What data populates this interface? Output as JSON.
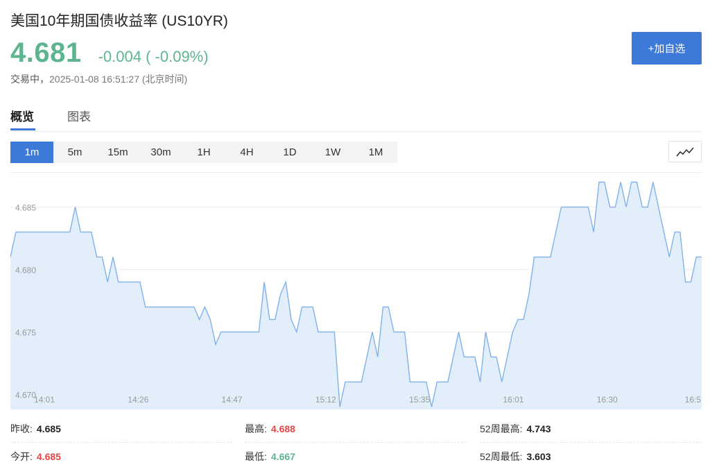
{
  "header": {
    "title": "美国10年期国债收益率 (US10YR)",
    "price": "4.681",
    "change": "-0.004 ( -0.09%)",
    "status": "交易中，",
    "timestamp": "2025-01-08 16:51:27",
    "timezone": "(北京时间)",
    "watch_button": "+加自选"
  },
  "tabs": [
    {
      "label": "概览",
      "active": true
    },
    {
      "label": "图表",
      "active": false
    }
  ],
  "periods": [
    {
      "label": "1m",
      "active": true
    },
    {
      "label": "5m",
      "active": false
    },
    {
      "label": "15m",
      "active": false
    },
    {
      "label": "30m",
      "active": false
    },
    {
      "label": "1H",
      "active": false
    },
    {
      "label": "4H",
      "active": false
    },
    {
      "label": "1D",
      "active": false
    },
    {
      "label": "1W",
      "active": false
    },
    {
      "label": "1M",
      "active": false
    }
  ],
  "chart_type_icon": "line-chart-icon",
  "colors": {
    "accent": "#3d79d8",
    "up": "#e64545",
    "down": "#5cb58e",
    "line": "#7fb1ec",
    "fill": "#e3eefb"
  },
  "chart_data": {
    "type": "area",
    "x_ticks": [
      "14:01",
      "14:26",
      "14:47",
      "15:12",
      "15:35",
      "16:01",
      "16:30",
      "16:5"
    ],
    "y_ticks": [
      "4.685",
      "4.680",
      "4.675",
      "4.670"
    ],
    "ylim": [
      4.6688,
      4.6878
    ],
    "values": [
      4.681,
      4.683,
      4.683,
      4.683,
      4.683,
      4.683,
      4.683,
      4.683,
      4.683,
      4.683,
      4.683,
      4.683,
      4.685,
      4.683,
      4.683,
      4.683,
      4.681,
      4.681,
      4.679,
      4.681,
      4.679,
      4.679,
      4.679,
      4.679,
      4.679,
      4.677,
      4.677,
      4.677,
      4.677,
      4.677,
      4.677,
      4.677,
      4.677,
      4.677,
      4.677,
      4.676,
      4.677,
      4.676,
      4.674,
      4.675,
      4.675,
      4.675,
      4.675,
      4.675,
      4.675,
      4.675,
      4.675,
      4.679,
      4.676,
      4.676,
      4.678,
      4.679,
      4.676,
      4.675,
      4.677,
      4.677,
      4.677,
      4.675,
      4.675,
      4.675,
      4.675,
      4.669,
      4.671,
      4.671,
      4.671,
      4.671,
      4.673,
      4.675,
      4.673,
      4.677,
      4.677,
      4.675,
      4.675,
      4.675,
      4.671,
      4.671,
      4.671,
      4.671,
      4.669,
      4.671,
      4.671,
      4.671,
      4.673,
      4.675,
      4.673,
      4.673,
      4.673,
      4.671,
      4.675,
      4.673,
      4.673,
      4.671,
      4.673,
      4.675,
      4.676,
      4.676,
      4.678,
      4.681,
      4.681,
      4.681,
      4.681,
      4.683,
      4.685,
      4.685,
      4.685,
      4.685,
      4.685,
      4.685,
      4.683,
      4.687,
      4.687,
      4.685,
      4.685,
      4.687,
      4.685,
      4.687,
      4.687,
      4.685,
      4.685,
      4.687,
      4.685,
      4.683,
      4.681,
      4.683,
      4.683,
      4.679,
      4.679,
      4.681,
      4.681
    ]
  },
  "stats": {
    "prev_close_label": "昨收:",
    "prev_close": "4.685",
    "open_label": "今开:",
    "open": "4.685",
    "high_label": "最高:",
    "high": "4.688",
    "low_label": "最低:",
    "low": "4.667",
    "high52_label": "52周最高:",
    "high52": "4.743",
    "low52_label": "52周最低:",
    "low52": "3.603"
  }
}
